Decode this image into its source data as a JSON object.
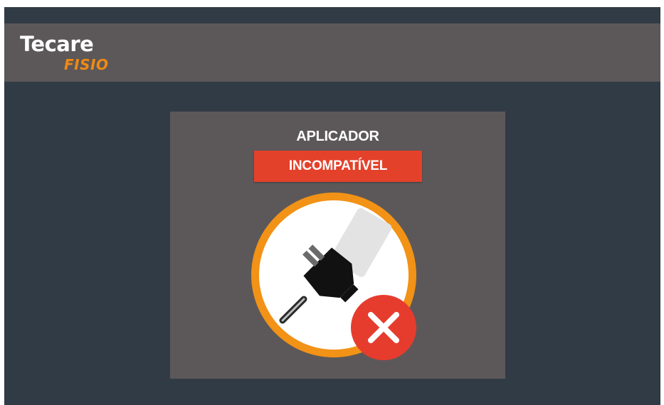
{
  "header": {
    "logo_main": "Tecare",
    "logo_sub": "FISIO"
  },
  "dialog": {
    "title": "APLICADOR",
    "status": "INCOMPATÍVEL",
    "illustration_icon": "unplugged-applicator-icon",
    "error_icon": "close-icon"
  },
  "colors": {
    "background": "#313b45",
    "header": "#5c5859",
    "panel": "#5c5859",
    "accent_orange": "#f08a12",
    "error_red": "#e4412b"
  }
}
